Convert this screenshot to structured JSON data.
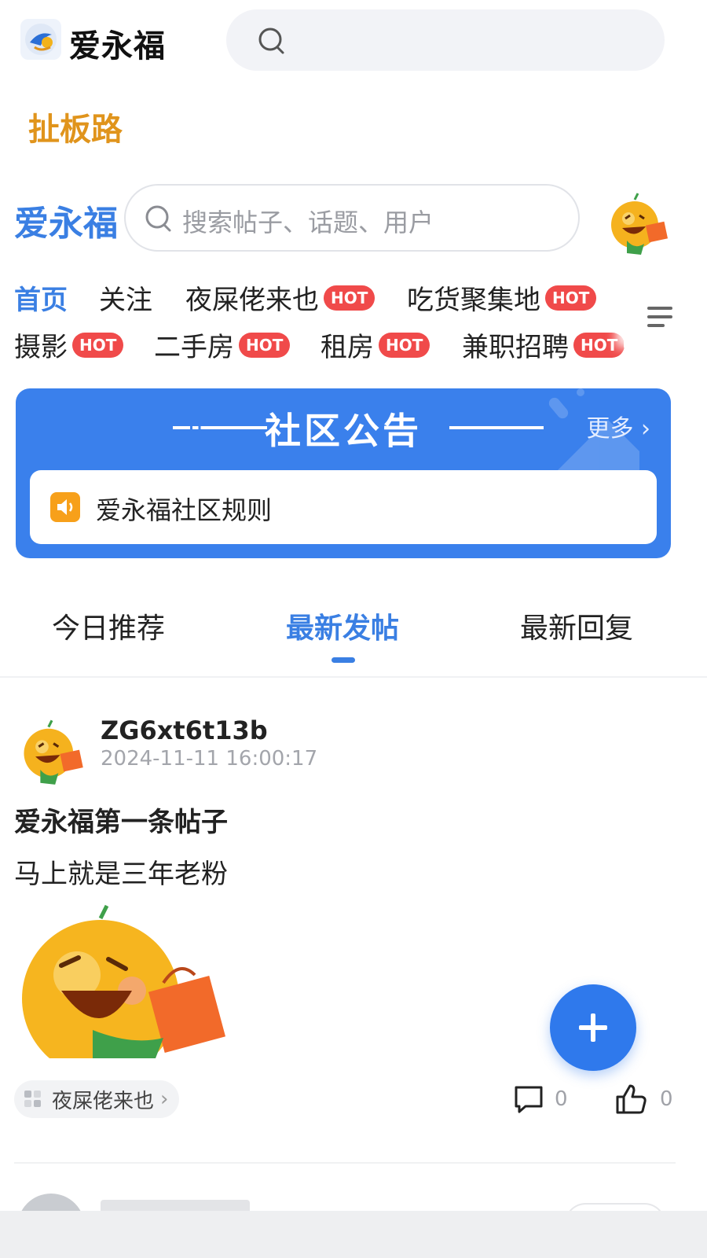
{
  "topbar": {
    "app_name": "爱永福",
    "search_placeholder": ""
  },
  "header_link": "扯板路",
  "forum_header": {
    "brand": "爱永福",
    "search_placeholder": "搜索帖子、话题、用户"
  },
  "categories": [
    {
      "label": "首页",
      "hot": false,
      "active": true
    },
    {
      "label": "关注",
      "hot": false,
      "active": false
    },
    {
      "label": "夜屎佬来也",
      "hot": true,
      "active": false
    },
    {
      "label": "吃货聚集地",
      "hot": true,
      "active": false
    },
    {
      "label": "摄影",
      "hot": true,
      "active": false
    },
    {
      "label": "二手房",
      "hot": true,
      "active": false
    },
    {
      "label": "租房",
      "hot": true,
      "active": false
    },
    {
      "label": "兼职招聘",
      "hot": true,
      "active": false
    }
  ],
  "hot_badge": "HOT",
  "announcement": {
    "title": "社区公告",
    "more": "更多",
    "item": "爱永福社区规则"
  },
  "tabs": [
    {
      "label": "今日推荐",
      "active": false
    },
    {
      "label": "最新发帖",
      "active": true
    },
    {
      "label": "最新回复",
      "active": false
    }
  ],
  "post": {
    "username": "ZG6xt6t13b",
    "time": "2024-11-11 16:00:17",
    "title": "爱永福第一条帖子",
    "body": "马上就是三年老粉",
    "tag": "夜屎佬来也",
    "comments": "0",
    "likes": "0"
  },
  "colors": {
    "accent": "#3a7fe3",
    "notice_bg": "#3a80ec",
    "hot": "#f04a4a",
    "orange": "#e0941c"
  }
}
